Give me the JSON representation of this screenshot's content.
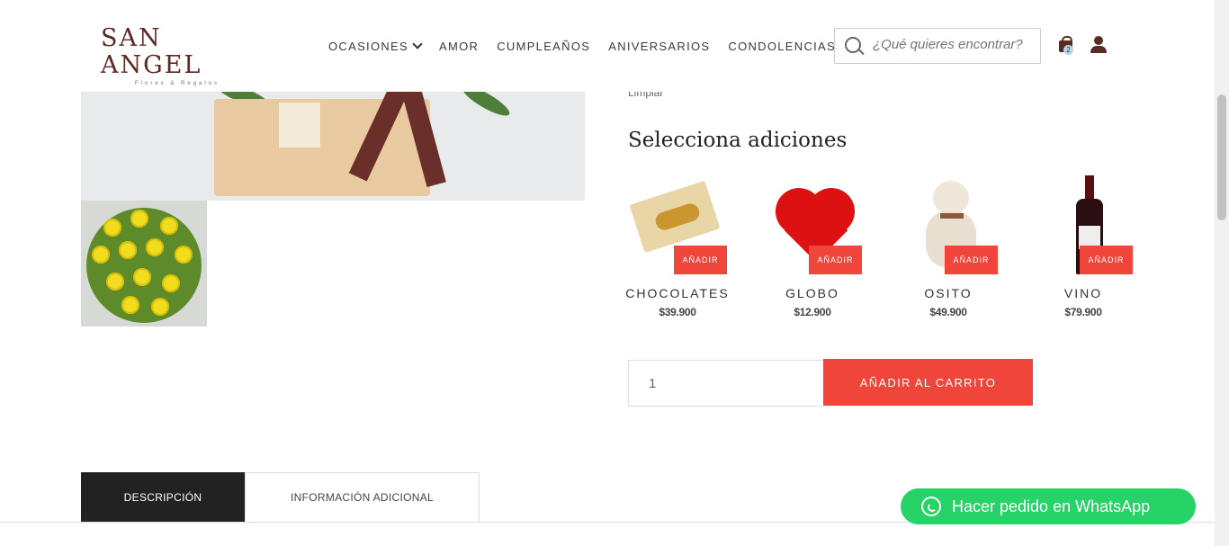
{
  "header": {
    "logo": {
      "main": "SAN ANGEL",
      "sub": "Flores & Regalos"
    },
    "nav": [
      {
        "label": "OCASIONES",
        "has_dropdown": true
      },
      {
        "label": "AMOR"
      },
      {
        "label": "CUMPLEAÑOS"
      },
      {
        "label": "ANIVERSARIOS"
      },
      {
        "label": "CONDOLENCIAS"
      }
    ],
    "search": {
      "placeholder": "¿Qué quieres encontrar?"
    },
    "cart": {
      "count": "2",
      "icon": "shopping-bag-icon"
    },
    "account": {
      "icon": "user-icon"
    }
  },
  "product": {
    "clear_label": "Limpiar",
    "addons_title": "Selecciona adiciones",
    "addons": [
      {
        "name": "CHOCOLATES",
        "price": "$39.900",
        "button": "AÑADIR"
      },
      {
        "name": "GLOBO",
        "price": "$12.900",
        "button": "AÑADIR"
      },
      {
        "name": "OSITO",
        "price": "$49.900",
        "button": "AÑADIR"
      },
      {
        "name": "VINO",
        "price": "$79.900",
        "button": "AÑADIR"
      }
    ],
    "quantity": "1",
    "add_to_cart": "AÑADIR AL CARRITO"
  },
  "tabs": [
    {
      "label": "DESCRIPCIÓN",
      "active": true
    },
    {
      "label": "INFORMACIÓN ADICIONAL",
      "active": false
    }
  ],
  "whatsapp": {
    "label": "Hacer pedido en WhatsApp",
    "color": "#26d366"
  },
  "colors": {
    "accent": "#f0453b",
    "brand": "#5a2a24",
    "tab_active": "#222222"
  }
}
